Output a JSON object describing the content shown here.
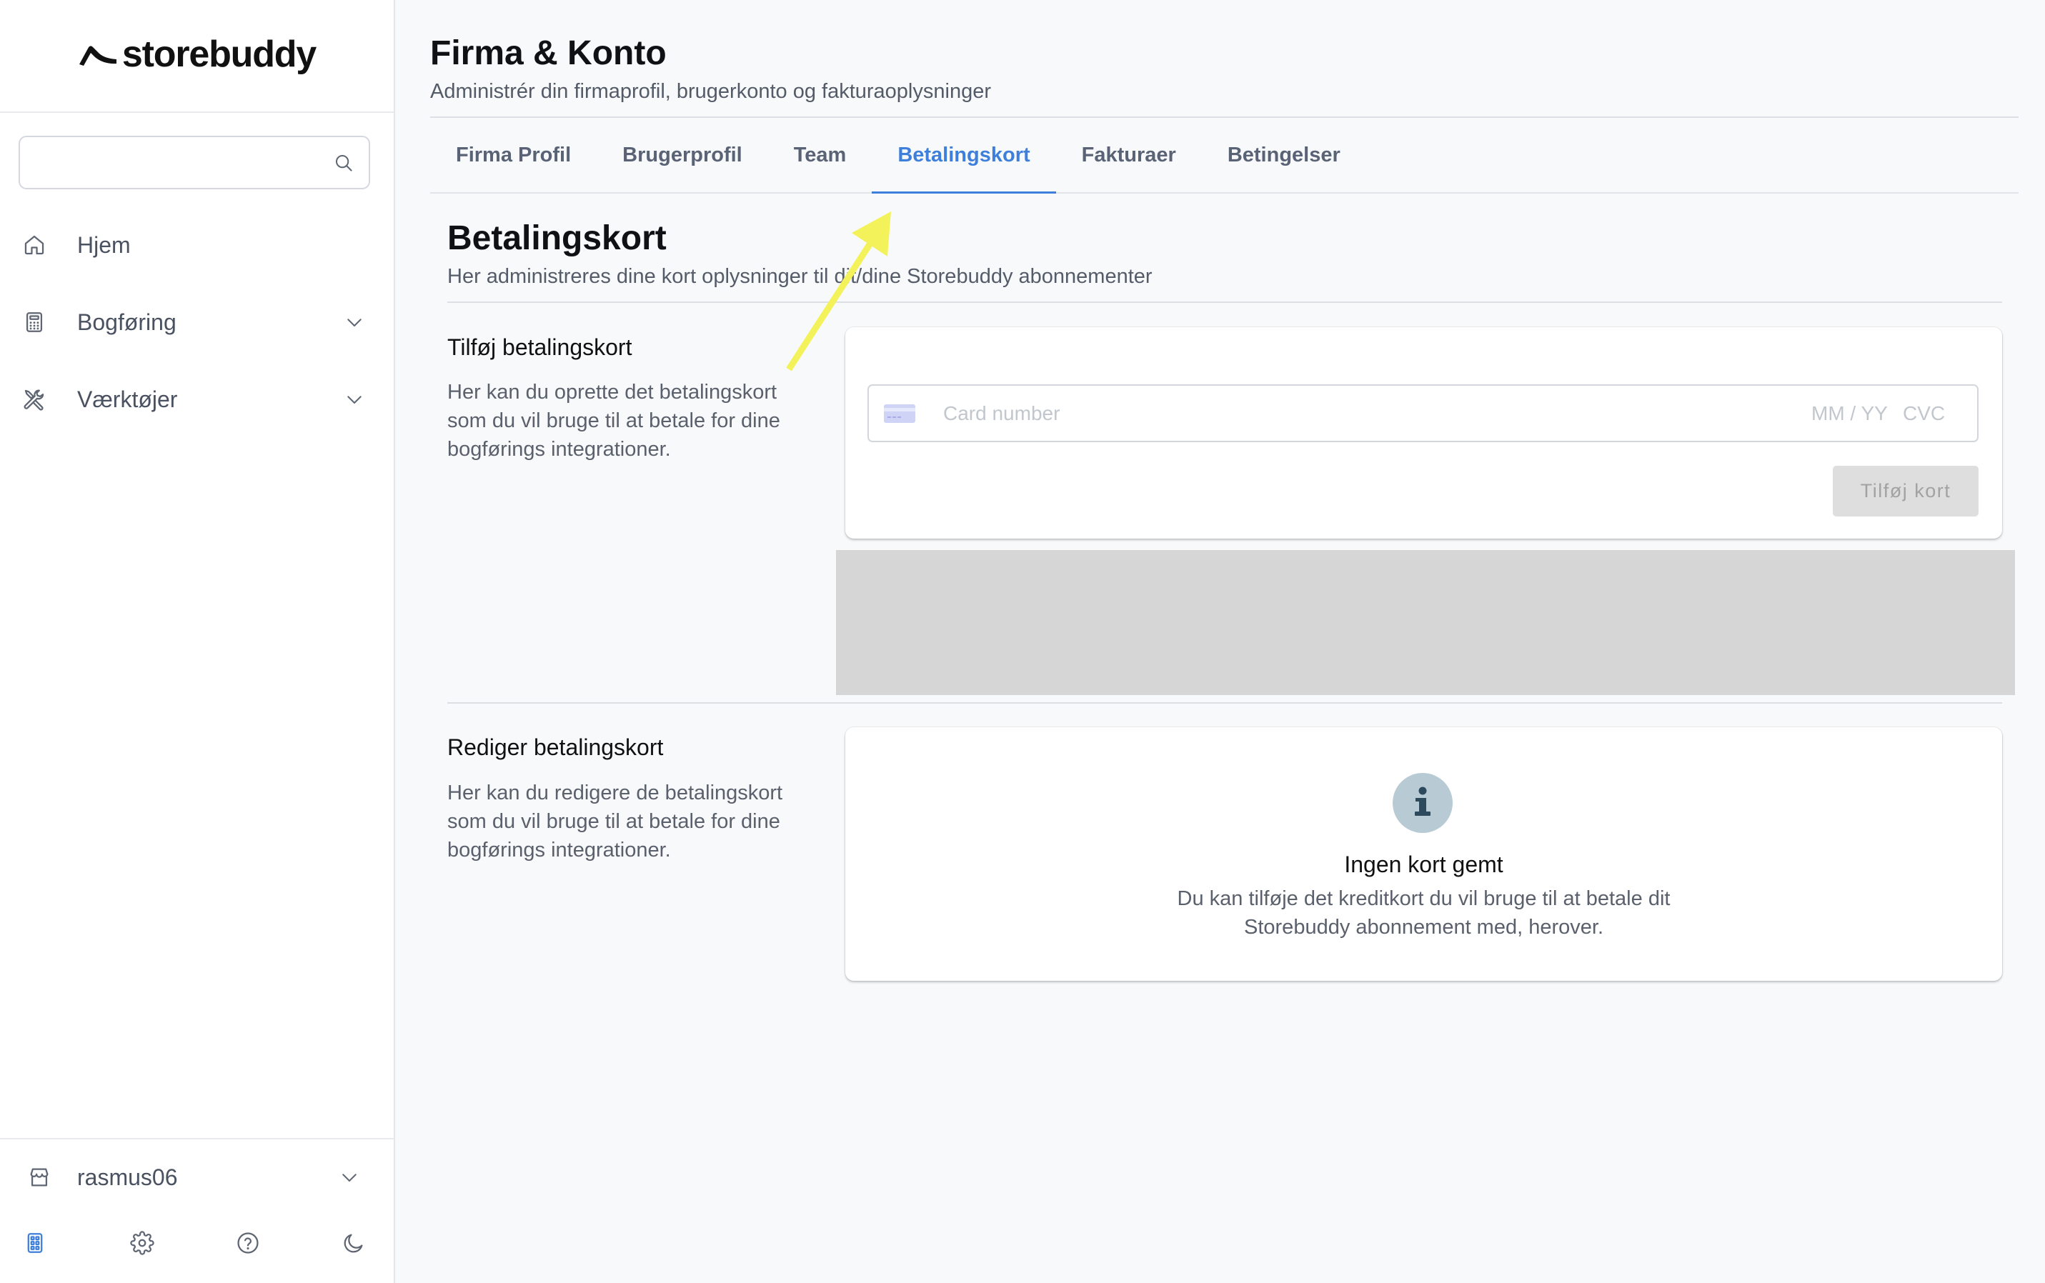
{
  "colors": {
    "accent": "#3f7fdc",
    "sidebar_bg": "#ffffff",
    "main_bg": "#f8f9fb",
    "placeholder_block": "#d6d6d6",
    "info_icon_bg": "#b8cbd5",
    "annotation_arrow": "#f4f25a"
  },
  "brand": {
    "logo_text": "storebuddy",
    "logo_icon": "storebuddy-swoosh-icon"
  },
  "sidebar": {
    "search": {
      "icon": "search-icon"
    },
    "nav": [
      {
        "label": "Hjem",
        "icon": "home-icon"
      },
      {
        "label": "Bogføring",
        "icon": "calculator-icon",
        "chevron": "chevron-down-icon"
      },
      {
        "label": "Værktøjer",
        "icon": "tools-icon",
        "chevron": "chevron-down-icon"
      }
    ],
    "account": {
      "name": "rasmus06",
      "icon": "store-icon",
      "chevron": "chevron-down-icon"
    },
    "footer_icons": [
      {
        "icon": "apps-icon",
        "active": true
      },
      {
        "icon": "gear-icon"
      },
      {
        "icon": "help-icon"
      },
      {
        "icon": "moon-icon"
      }
    ]
  },
  "header": {
    "title": "Firma & Konto",
    "subtitle": "Administrér din firmaprofil, brugerkonto og fakturaoplysninger"
  },
  "tabs": [
    {
      "label": "Firma Profil"
    },
    {
      "label": "Brugerprofil"
    },
    {
      "label": "Team"
    },
    {
      "label": "Betalingskort",
      "active": true
    },
    {
      "label": "Fakturaer"
    },
    {
      "label": "Betingelser"
    }
  ],
  "page": {
    "title": "Betalingskort",
    "subtitle": "Her administreres dine kort oplysninger til dit/dine Storebuddy abonnementer",
    "add_card": {
      "title": "Tilføj betalingskort",
      "description": "Her kan du oprette det betalingskort som du vil bruge til at betale for dine bogførings integrationer.",
      "card_input": {
        "card_icon": "credit-card-icon",
        "number_placeholder": "Card number",
        "expiry_placeholder": "MM / YY",
        "cvc_placeholder": "CVC"
      },
      "submit_label": "Tilføj kort"
    },
    "edit_card": {
      "title": "Rediger betalingskort",
      "description": "Her kan du redigere de betalingskort som du vil bruge til at betale for dine bogførings integrationer.",
      "empty_state": {
        "icon": "info-icon",
        "title": "Ingen kort gemt",
        "message": "Du kan tilføje det kreditkort du vil bruge til at betale dit Storebuddy abonnement med, herover."
      }
    }
  }
}
